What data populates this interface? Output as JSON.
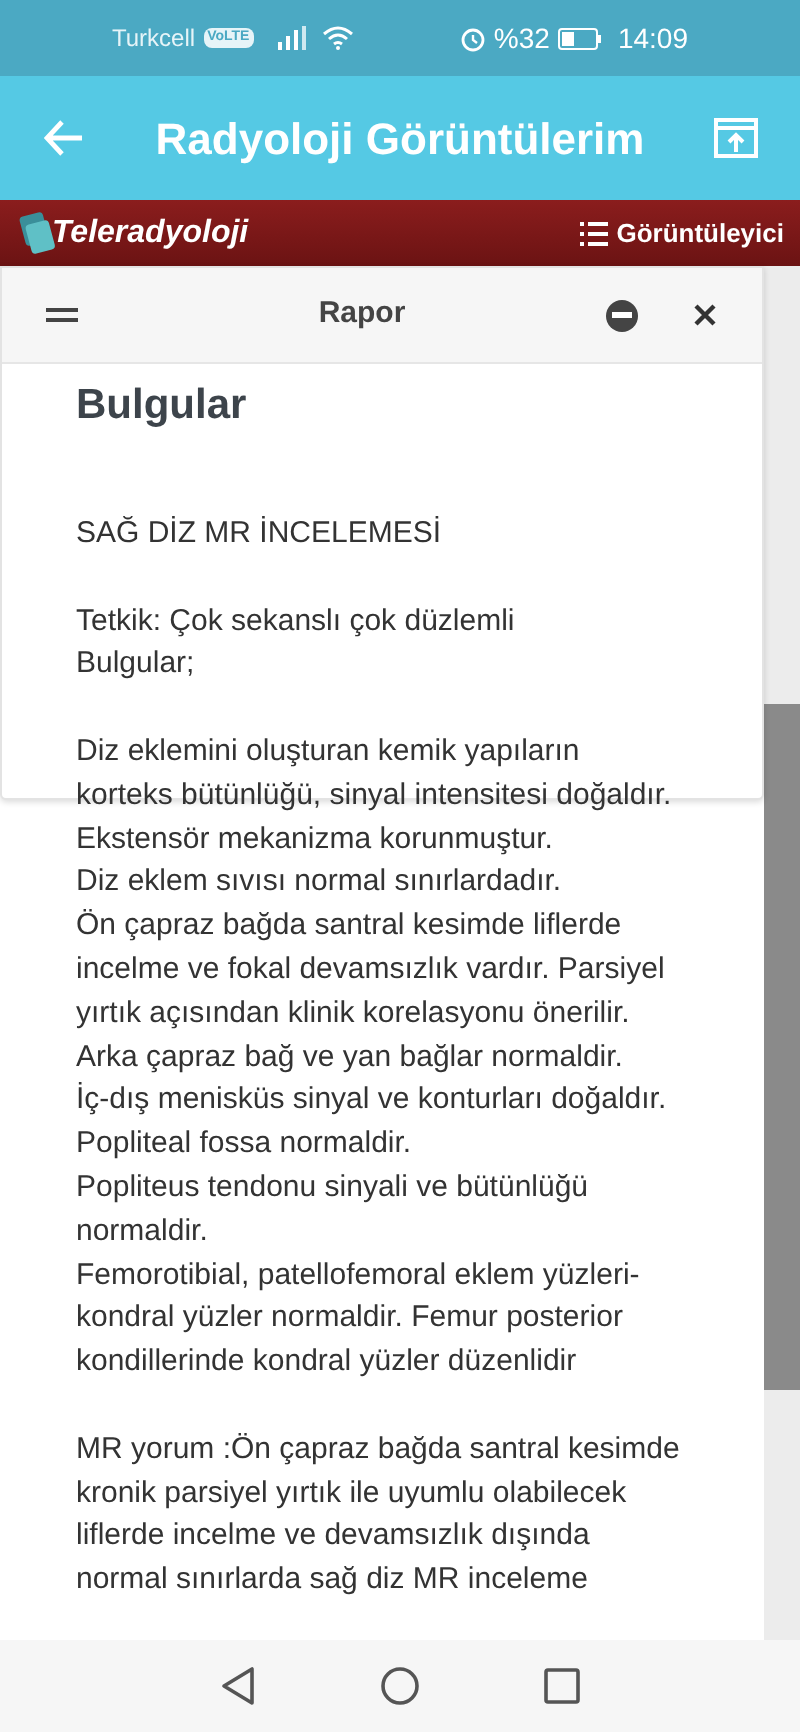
{
  "status_bar": {
    "carrier": "Turkcell",
    "volte": "VoLTE",
    "battery": "%32",
    "time": "14:09"
  },
  "app_bar": {
    "title": "Radyoloji Görüntülerim"
  },
  "banner": {
    "logo": "Teleradyoloji",
    "viewer_button": "Görüntüleyici"
  },
  "panel": {
    "title": "Rapor"
  },
  "report": {
    "heading": "Bulgular",
    "paragraphs": [
      [
        "SAĞ DİZ MR İNCELEMESİ"
      ],
      [
        "Tetkik: Çok sekanslı çok düzlemli",
        "Bulgular;"
      ],
      [
        "Diz eklemini oluşturan kemik yapıların",
        "korteks bütünlüğü, sinyal intensitesi doğaldır.",
        "Ekstensör mekanizma korunmuştur.",
        "Diz eklem sıvısı normal sınırlardadır.",
        "Ön çapraz bağda santral kesimde liflerde",
        "incelme ve fokal devamsızlık vardır. Parsiyel",
        "yırtık açısından klinik korelasyonu önerilir.",
        "Arka çapraz bağ ve yan bağlar normaldir.",
        "İç-dış menisküs sinyal ve konturları doğaldır.",
        "Popliteal fossa normaldir.",
        "Popliteus tendonu sinyali ve bütünlüğü",
        "normaldir.",
        "Femorotibial, patellofemoral eklem yüzleri-",
        "kondral yüzler normaldir. Femur posterior",
        "kondillerinde kondral yüzler düzenlidir"
      ],
      [
        "MR yorum :Ön çapraz bağda santral kesimde",
        "kronik parsiyel yırtık ile uyumlu olabilecek",
        "liflerde incelme ve devamsızlık dışında",
        "normal sınırlarda sağ diz MR inceleme"
      ]
    ]
  }
}
